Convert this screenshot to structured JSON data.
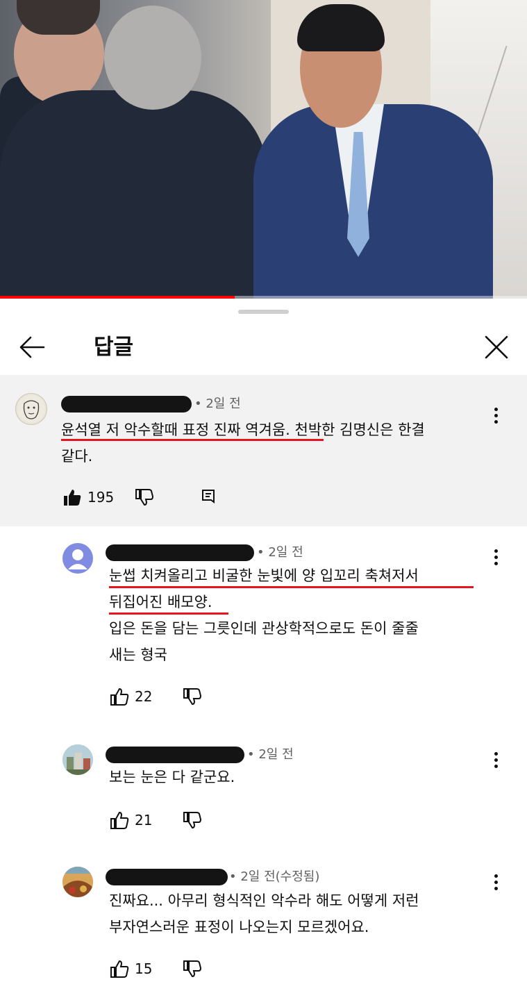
{
  "sheet": {
    "title": "답글"
  },
  "video": {
    "progress": 0.445
  },
  "comments": [
    {
      "time": "• 2일 전",
      "lines": [
        "윤석열 저 악수할때 표정 진짜 역겨움. 천박한 김명신은 한결",
        "같다."
      ],
      "likes": "195",
      "liked": true,
      "has_reply_icon": true
    },
    {
      "time": "• 2일 전",
      "lines": [
        "눈썹 치켜올리고 비굴한 눈빛에 양 입꼬리 축쳐저서",
        "뒤집어진 배모양.",
        "입은 돈을 담는 그릇인데 관상학적으로도 돈이 줄줄",
        "새는 형국"
      ],
      "likes": "22"
    },
    {
      "time": "• 2일 전",
      "lines": [
        "보는 눈은 다 같군요."
      ],
      "likes": "21"
    },
    {
      "time": "• 2일 전(수정됨)",
      "lines": [
        "진짜요... 아무리 형식적인 악수라 해도 어떻게 저런",
        "부자연스러운 표정이 나오는지 모르겠어요."
      ],
      "likes": "15"
    }
  ],
  "icons": {
    "back": "arrow-left-icon",
    "close": "close-icon",
    "like": "thumb-up-icon",
    "dislike": "thumb-down-icon",
    "reply": "comment-reply-icon",
    "more": "more-vertical-icon"
  },
  "colors": {
    "highlight": "#e5141e",
    "progress": "#ff0000",
    "parent_bg": "#f2f2f2"
  }
}
